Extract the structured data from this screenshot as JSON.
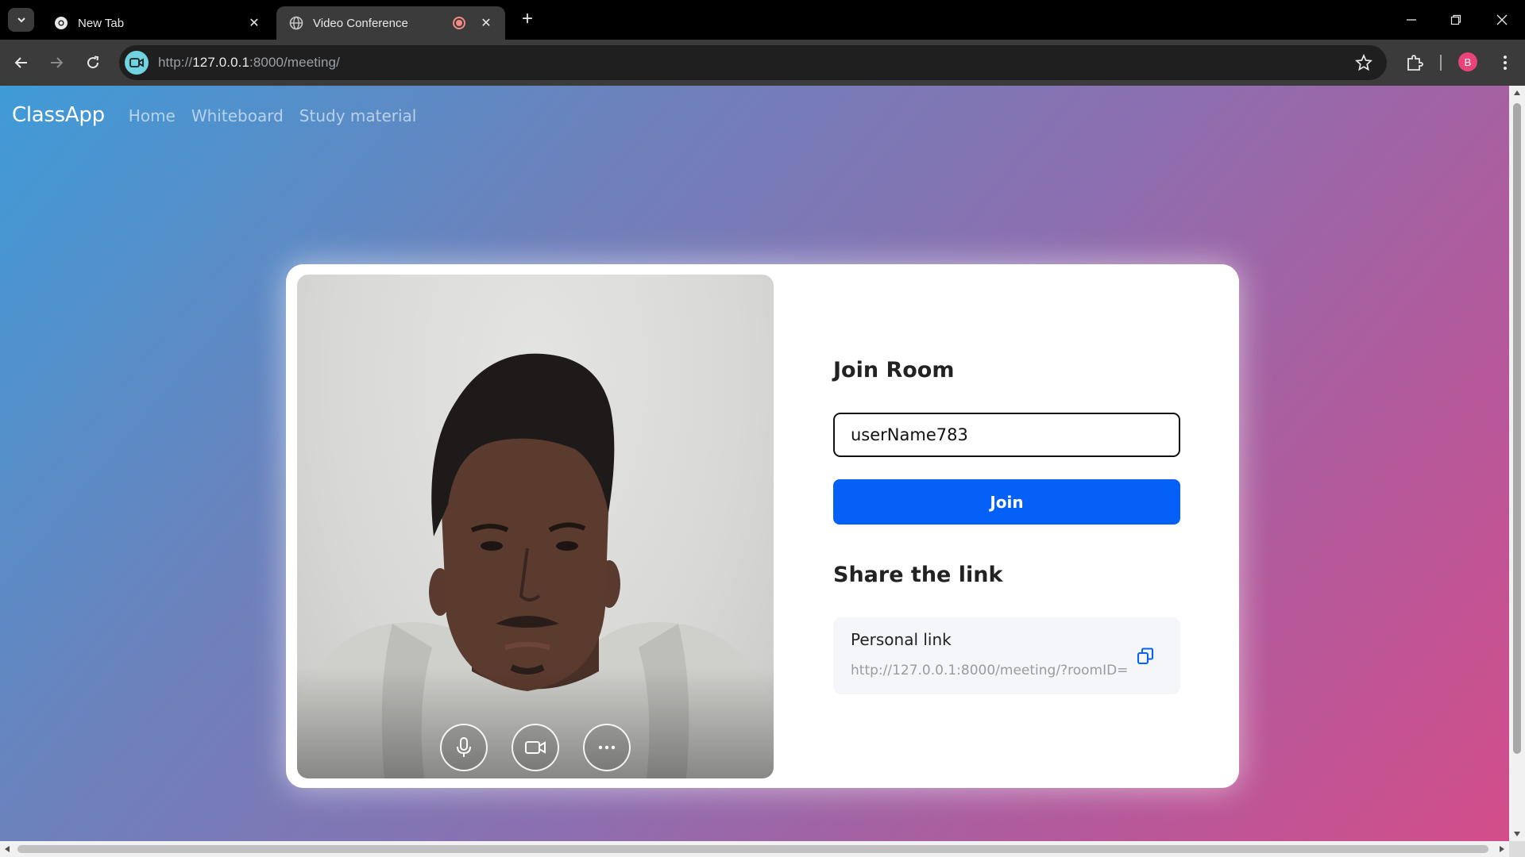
{
  "browser": {
    "tabs": [
      {
        "title": "New Tab",
        "favicon": "chrome-icon",
        "active": false
      },
      {
        "title": "Video Conference",
        "favicon": "globe-icon",
        "active": true,
        "recording": true
      }
    ],
    "url": {
      "scheme": "http://",
      "host": "127.0.0.1",
      "rest": ":8000/meeting/"
    },
    "profile_initial": "B"
  },
  "navbar": {
    "brand": "ClassApp",
    "links": [
      "Home",
      "Whiteboard",
      "Study material"
    ]
  },
  "video": {
    "controls": [
      "microphone-icon",
      "video-camera-icon",
      "more-options-icon"
    ]
  },
  "join": {
    "title": "Join Room",
    "username_value": "userName783",
    "button_label": "Join"
  },
  "share": {
    "title": "Share the link",
    "link_label": "Personal link",
    "link_url": "http://127.0.0.1:8000/meeting/?roomID="
  },
  "colors": {
    "primary_button": "#0560f7",
    "profile_badge": "#e8447a",
    "recording": "#f28b82"
  }
}
